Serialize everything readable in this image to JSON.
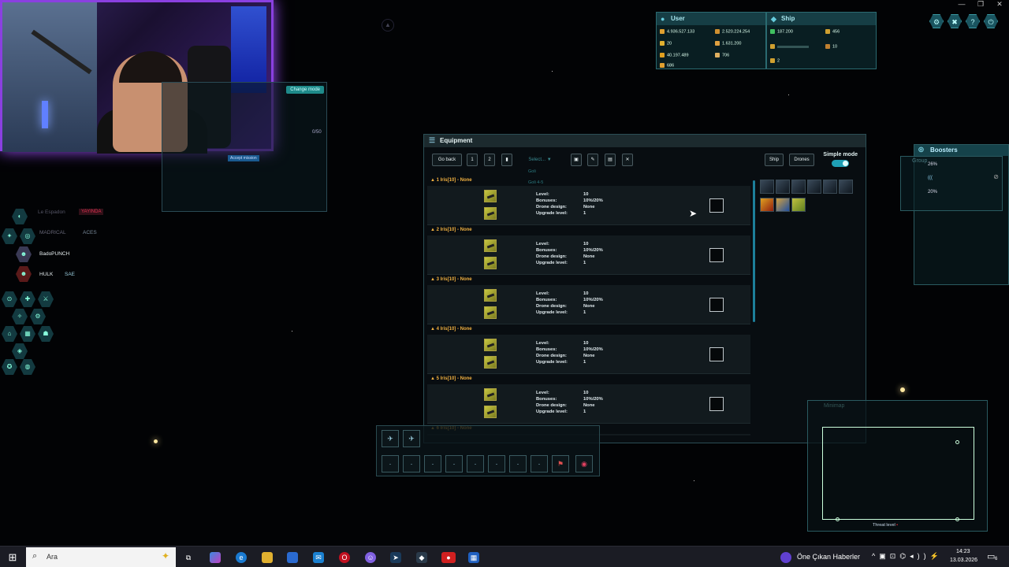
{
  "window_controls": {
    "minimize": "—",
    "maximize": "❐",
    "close": "✕"
  },
  "webcam_overlay": {
    "change_mode_label": "Change mode",
    "ratio_label": "0/50",
    "accept_label": "Accept mission"
  },
  "user_panel": {
    "title": "User",
    "stats": [
      {
        "icon": "uridium-icon",
        "value": "4.936.527.133"
      },
      {
        "icon": "credits-icon",
        "value": "2.520.224.254"
      },
      {
        "icon": "honor-icon",
        "value": "20"
      },
      {
        "icon": "experience-icon",
        "value": "1.631.200"
      },
      {
        "icon": "level-icon",
        "value": "40.197.489"
      },
      {
        "icon": "jackpot-icon",
        "value": "706"
      },
      {
        "icon": "ammo-icon",
        "value": "686"
      }
    ]
  },
  "ship_panel": {
    "title": "Ship",
    "stats": [
      {
        "icon": "hp-icon",
        "value": "187.200"
      },
      {
        "icon": "cargo-icon",
        "value": "456"
      },
      {
        "icon": "shield-icon",
        "value": ""
      },
      {
        "icon": "speed-icon",
        "value": "10"
      },
      {
        "icon": "config-icon",
        "value": "2"
      }
    ]
  },
  "top_icons": [
    "settings-icon",
    "close-all-icon",
    "help-icon",
    "logout-icon"
  ],
  "equipment": {
    "title": "Equipment",
    "toolbar": {
      "go_back": "Go back",
      "config_1": "1",
      "config_2": "2",
      "select": "Select... ▼",
      "select_options": [
        "Goli",
        "Goli 4-5"
      ],
      "ship_tab": "Ship",
      "drones_tab": "Drones",
      "simple_mode": "Simple mode"
    },
    "drone_labels": {
      "level": "Level:",
      "bonuses": "Bonuses:",
      "design": "Drone design:",
      "upgrade": "Upgrade level:"
    },
    "drones": [
      {
        "header": "▲ 1 Iris[10] - None",
        "level": "10",
        "bonuses": "10%/20%",
        "design": "None",
        "upgrade": "1"
      },
      {
        "header": "▲ 2 Iris[10] - None",
        "level": "10",
        "bonuses": "10%/20%",
        "design": "None",
        "upgrade": "1"
      },
      {
        "header": "▲ 3 Iris[10] - None",
        "level": "10",
        "bonuses": "10%/20%",
        "design": "None",
        "upgrade": "1"
      },
      {
        "header": "▲ 4 Iris[10] - None",
        "level": "10",
        "bonuses": "10%/20%",
        "design": "None",
        "upgrade": "1"
      },
      {
        "header": "▲ 5 Iris[10] - None",
        "level": "10",
        "bonuses": "10%/20%",
        "design": "None",
        "upgrade": "1"
      },
      {
        "header": "▲ 6 Iris[10] - None",
        "level": "",
        "bonuses": "",
        "design": "",
        "upgrade": ""
      }
    ]
  },
  "boosters": {
    "title": "Boosters",
    "group_label": "Group",
    "rows": [
      "26%",
      "(((",
      "20%"
    ]
  },
  "minimap": {
    "title": "Minimap",
    "threat_label": "Threat level"
  },
  "social": {
    "entries": [
      {
        "name": "Le Espadon",
        "badge": "YAYINDA"
      },
      {
        "name": "MADRICAL",
        "badge": "ACES"
      },
      {
        "name": "BadoPUNCH",
        "badge": ""
      },
      {
        "name": "HULK",
        "badge": "SAE"
      }
    ]
  },
  "taskbar": {
    "search_placeholder": "Ara",
    "news": "Öne Çıkan Haberler",
    "time": "14:23",
    "date": "13.03.2026",
    "notifications": "6"
  },
  "colors": {
    "accent": "#1f9fb5",
    "panel_header": "#163e45",
    "drone_header": "#f0b040",
    "webcam_border": "#8a40e0"
  }
}
